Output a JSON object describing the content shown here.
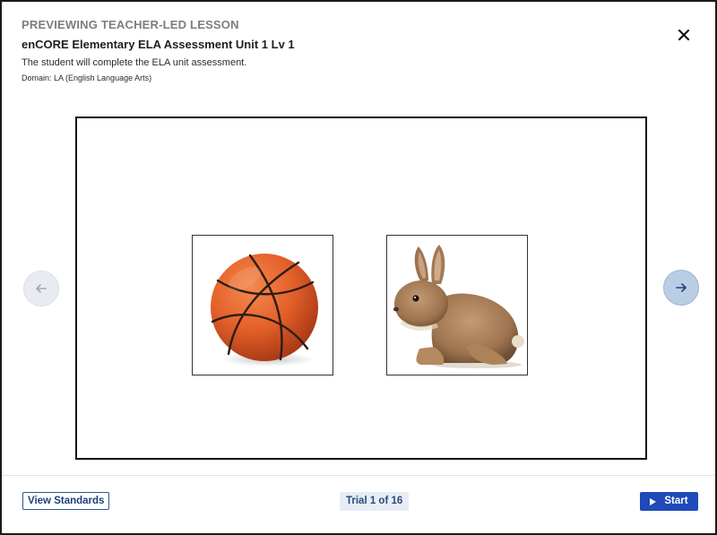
{
  "header": {
    "eyebrow": "PREVIEWING TEACHER-LED LESSON",
    "title": "enCORE Elementary ELA Assessment Unit 1 Lv 1",
    "description": "The student will complete the ELA unit assessment.",
    "domain": "Domain: LA (English Language Arts)"
  },
  "icons": {
    "close": "close-icon",
    "prev": "arrow-left-icon",
    "next": "arrow-right-icon",
    "start": "play-icon"
  },
  "stage": {
    "cards": [
      {
        "image": "basketball"
      },
      {
        "image": "rabbit"
      }
    ]
  },
  "footer": {
    "standards_label": "View Standards",
    "trial_label": "Trial 1 of 16",
    "start_label": "Start"
  },
  "colors": {
    "accent": "#1f4ab8",
    "eyebrow": "#7d7d7d",
    "trial_bg": "#e6edf5",
    "next_bg": "#b9cde4",
    "prev_bg": "#e8ecf2"
  }
}
